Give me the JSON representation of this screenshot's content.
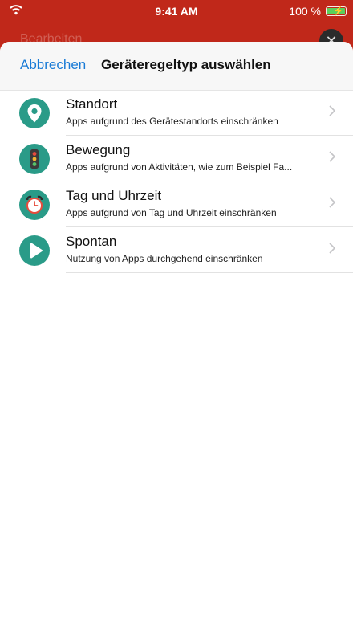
{
  "status_bar": {
    "time": "9:41 AM",
    "battery": "100 %"
  },
  "background": {
    "title": "Bearbeiten"
  },
  "nav": {
    "cancel_label": "Abbrechen",
    "title": "Geräteregeltyp auswählen"
  },
  "rules": [
    {
      "title": "Standort",
      "subtitle": "Apps aufgrund des Gerätestandorts einschränken",
      "icon": "location-pin-icon"
    },
    {
      "title": "Bewegung",
      "subtitle": "Apps aufgrund von Aktivitäten, wie zum Beispiel Fa...",
      "icon": "traffic-light-icon"
    },
    {
      "title": "Tag und Uhrzeit",
      "subtitle": "Apps aufgrund von Tag und Uhrzeit einschränken",
      "icon": "alarm-clock-icon"
    },
    {
      "title": "Spontan",
      "subtitle": "Nutzung von Apps durchgehend einschränken",
      "icon": "play-icon"
    }
  ],
  "colors": {
    "accent": "#1a7bd6",
    "icon_bg": "#2a9b88",
    "header_red": "#c0281a"
  }
}
